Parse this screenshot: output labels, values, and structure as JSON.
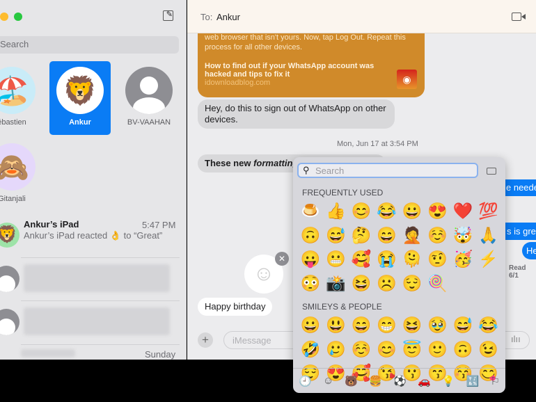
{
  "sidebar": {
    "search_placeholder": "Search",
    "pins": [
      {
        "name": "ébastien",
        "emoji": "🏖️"
      },
      {
        "name": "Ankur",
        "emoji": "🦁"
      },
      {
        "name": "BV-VAAHAN"
      },
      {
        "name": "Gitanjali",
        "emoji": "🙈"
      }
    ],
    "conversations": [
      {
        "name": "Ankur’s iPad",
        "time": "5:47 PM",
        "preview_a": "Ankur’s iPad reacted",
        "preview_emoji": "👌",
        "preview_b": "to “Great”",
        "emoji": "🦁"
      },
      {
        "time": "Sunday"
      }
    ]
  },
  "chat": {
    "to_label": "To:",
    "recipient": "Ankur",
    "link_card": {
      "text": "web browser that isn't yours. Now, tap Log Out. Repeat this process for all other devices.",
      "title": "How to find out if your WhatsApp account was hacked and tips to fix it",
      "domain": "idownloadblog.com"
    },
    "messages": [
      {
        "text": "Hey, do this to sign out of WhatsApp on other devices."
      },
      {
        "text_a": "These new ",
        "text_i": "formatting"
      },
      {
        "text": "e neede"
      },
      {
        "text": "s is gre"
      },
      {
        "text": "He"
      },
      {
        "text": "Happy birthday"
      }
    ],
    "timestamp": "Mon, Jun 17 at 3:54 PM",
    "read": "Read 6/1",
    "input_placeholder": "iMessage"
  },
  "picker": {
    "search_placeholder": "Search",
    "freq_label": "FREQUENTLY USED",
    "smileys_label": "SMILEYS & PEOPLE",
    "frequent": [
      "🍮",
      "👍",
      "😊",
      "😂",
      "😀",
      "😍",
      "❤️",
      "💯",
      "🙃",
      "😅",
      "🤔",
      "😄",
      "🤦",
      "☺️",
      "🤯",
      "🙏",
      "😛",
      "😬",
      "🥰",
      "😭",
      "🫠",
      "🤨",
      "🥳",
      "⚡",
      "😳",
      "📸",
      "😆",
      "☹️",
      "😌",
      "🍭"
    ],
    "smileys": [
      "😀",
      "😃",
      "😄",
      "😁",
      "😆",
      "🥹",
      "😅",
      "😂",
      "🤣",
      "🥲",
      "☺️",
      "😊",
      "😇",
      "🙂",
      "🙃",
      "😉",
      "😌",
      "😍",
      "🥰",
      "😘",
      "😗",
      "😙",
      "😚",
      "😋"
    ],
    "tabs": [
      "🕘",
      "☺",
      "🐻",
      "🍔",
      "⚽",
      "🚗",
      "💡",
      "🔣",
      "⚐"
    ]
  },
  "colors": {
    "accent": "#0a7cf5",
    "card": "#d08a2a"
  }
}
